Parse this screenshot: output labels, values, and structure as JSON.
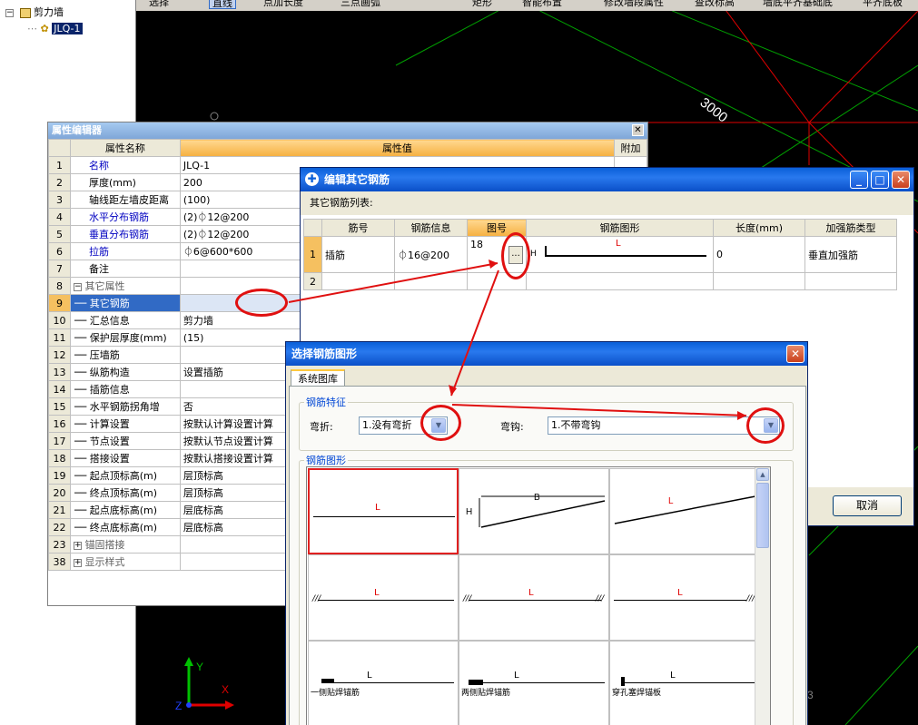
{
  "tree": {
    "root_label": "剪力墙",
    "child_label": "JLQ-1",
    "expand_symbol": "−"
  },
  "toolbar": {
    "items": [
      "选择",
      "直线",
      "点加长度",
      "三点画弧",
      "矩形",
      "智能布置",
      "修改墙段属性",
      "查改标高",
      "墙底平齐基础底",
      "平齐底板"
    ]
  },
  "cad": {
    "dimension": "3000",
    "axis_y": "Y",
    "axis_x": "X",
    "axis_z": "Z",
    "edge_digit": "3"
  },
  "property_editor": {
    "title": "属性编辑器",
    "header_name": "属性名称",
    "header_value": "属性值",
    "header_extra": "附加",
    "rows": [
      {
        "num": "1",
        "name": "名称",
        "value": "JLQ-1"
      },
      {
        "num": "2",
        "name": "厚度(mm)",
        "value": "200"
      },
      {
        "num": "3",
        "name": "轴线距左墙皮距离",
        "value": "(100)"
      },
      {
        "num": "4",
        "name": "水平分布钢筋",
        "value": "(2)⏀12@200"
      },
      {
        "num": "5",
        "name": "垂直分布钢筋",
        "value": "(2)⏀12@200"
      },
      {
        "num": "6",
        "name": "拉筋",
        "value": "⏀6@600*600"
      },
      {
        "num": "7",
        "name": "备注",
        "value": ""
      },
      {
        "num": "8",
        "name": "其它属性",
        "value": ""
      },
      {
        "num": "9",
        "name": "其它钢筋",
        "value": ""
      },
      {
        "num": "10",
        "name": "汇总信息",
        "value": "剪力墙"
      },
      {
        "num": "11",
        "name": "保护层厚度(mm)",
        "value": "(15)"
      },
      {
        "num": "12",
        "name": "压墙筋",
        "value": ""
      },
      {
        "num": "13",
        "name": "纵筋构造",
        "value": "设置插筋"
      },
      {
        "num": "14",
        "name": "插筋信息",
        "value": ""
      },
      {
        "num": "15",
        "name": "水平钢筋拐角增",
        "value": "否"
      },
      {
        "num": "16",
        "name": "计算设置",
        "value": "按默认计算设置计算"
      },
      {
        "num": "17",
        "name": "节点设置",
        "value": "按默认节点设置计算"
      },
      {
        "num": "18",
        "name": "搭接设置",
        "value": "按默认搭接设置计算"
      },
      {
        "num": "19",
        "name": "起点顶标高(m)",
        "value": "层顶标高"
      },
      {
        "num": "20",
        "name": "终点顶标高(m)",
        "value": "层顶标高"
      },
      {
        "num": "21",
        "name": "起点底标高(m)",
        "value": "层底标高"
      },
      {
        "num": "22",
        "name": "终点底标高(m)",
        "value": "层底标高"
      },
      {
        "num": "23",
        "name": "锚固搭接",
        "value": ""
      },
      {
        "num": "38",
        "name": "显示样式",
        "value": ""
      }
    ]
  },
  "edit_rebar": {
    "title": "编辑其它钢筋",
    "list_label": "其它钢筋列表:",
    "headers": [
      "筋号",
      "钢筋信息",
      "图号",
      "钢筋图形",
      "长度(mm)",
      "加强筋类型"
    ],
    "row1": {
      "num": "1",
      "name": "插筋",
      "info": "⏀16@200",
      "fig": "18",
      "ellipsis": "...",
      "shape_h": "H",
      "shape_l": "L",
      "length": "0",
      "type": "垂直加强筋"
    },
    "row2_num": "2",
    "cancel_label": "取消"
  },
  "select_shape": {
    "title": "选择钢筋图形",
    "tab": "系统图库",
    "feature_group": "钢筋特征",
    "bend_label": "弯折:",
    "bend_value": "1.没有弯折",
    "hook_label": "弯钩:",
    "hook_value": "1.不带弯钩",
    "shapes_group": "钢筋图形",
    "cell_L": "L",
    "cell_B": "B",
    "cell_H": "H",
    "cap_one_side": "一侧贴焊锚筋",
    "cap_two_side": "两侧贴焊锚筋",
    "cap_plug": "穿孔塞焊锚板"
  },
  "colors": {
    "title_blue": "#0a5fd8",
    "highlight_red": "#e01010",
    "cad_green": "#00a000",
    "cad_red": "#e00000"
  }
}
